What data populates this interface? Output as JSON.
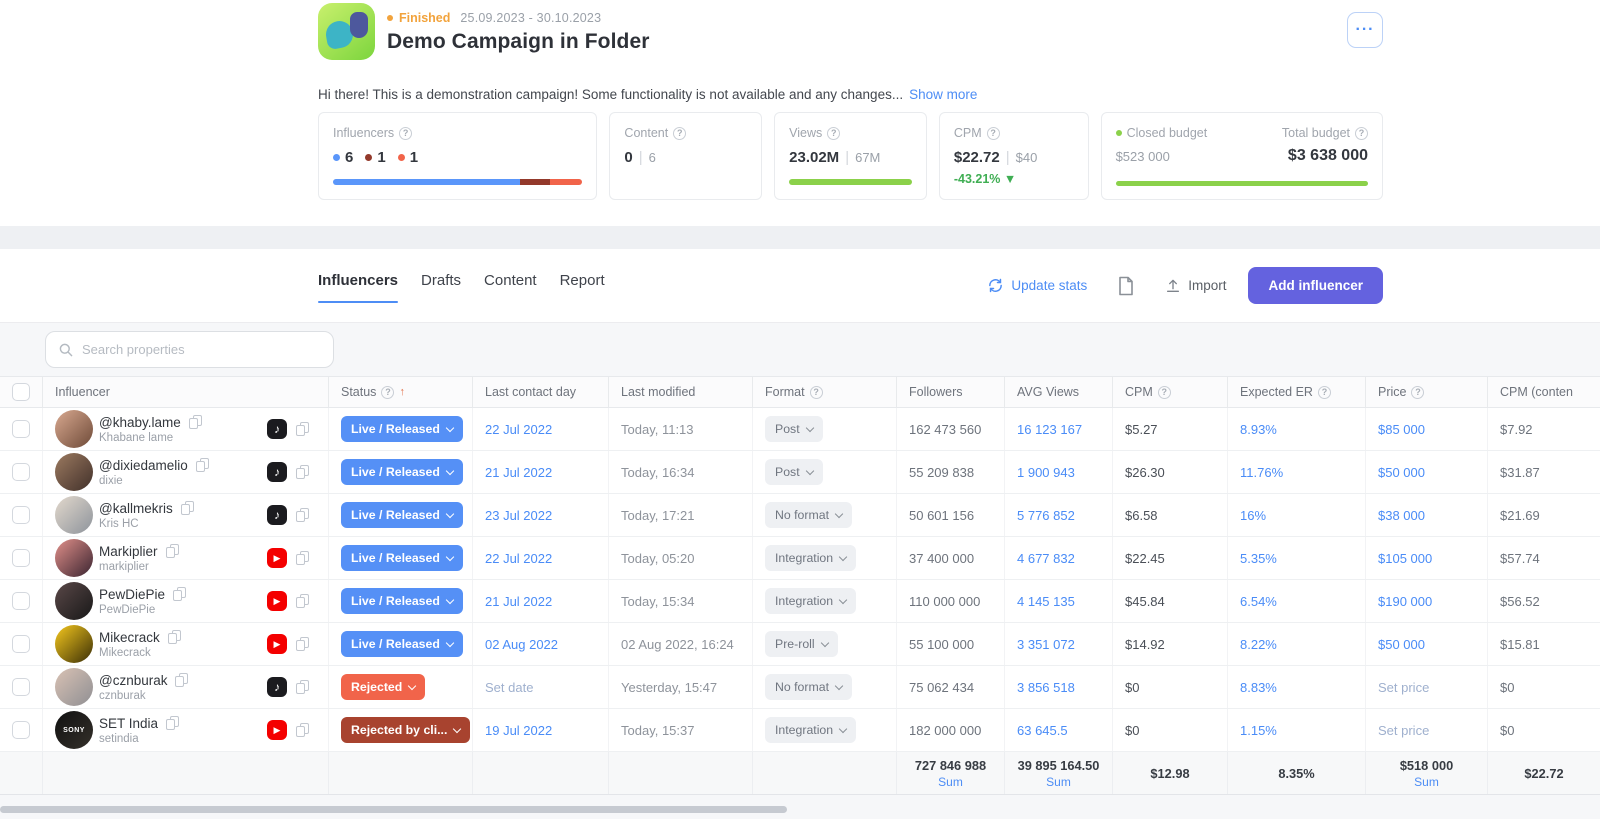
{
  "header": {
    "status_badge": "Finished",
    "date_range": "25.09.2023 - 30.10.2023",
    "title": "Demo Campaign in Folder",
    "menu_label": "···",
    "description": "Hi there! This is a demonstration campaign! Some functionality is not available and any changes...",
    "show_more_label": "Show more"
  },
  "stats": {
    "influencers": {
      "label": "Influencers",
      "items": [
        {
          "count": "6",
          "color": "#5a96fa",
          "width": "75%"
        },
        {
          "count": "1",
          "color": "#93392b",
          "width": "12%"
        },
        {
          "count": "1",
          "color": "#f1644a",
          "width": "13%"
        }
      ]
    },
    "content": {
      "label": "Content",
      "value": "0",
      "total": "6"
    },
    "views": {
      "label": "Views",
      "value": "23.02M",
      "total": "67M",
      "progress": "100%",
      "bar_color": "#8bd14a"
    },
    "cpm": {
      "label": "CPM",
      "value": "$22.72",
      "total": "$40",
      "delta": "-43.21% ▼",
      "delta_color": "#3fae53"
    },
    "budget": {
      "closed_label": "Closed budget",
      "closed_value": "$523 000",
      "total_label": "Total budget",
      "total_value": "$3 638 000",
      "progress": "100%",
      "bar_color": "#8bd14a",
      "dot_color": "#8bd14a"
    }
  },
  "tabs": [
    {
      "label": "Influencers"
    },
    {
      "label": "Drafts"
    },
    {
      "label": "Content"
    },
    {
      "label": "Report"
    }
  ],
  "toolbar": {
    "update_stats": "Update stats",
    "import_label": "Import",
    "add_influencer": "Add influencer"
  },
  "search": {
    "placeholder": "Search properties"
  },
  "table": {
    "columns": [
      {
        "label": "Influencer"
      },
      {
        "label": "Status"
      },
      {
        "label": "Last contact day"
      },
      {
        "label": "Last modified"
      },
      {
        "label": "Format"
      },
      {
        "label": "Followers"
      },
      {
        "label": "AVG Views"
      },
      {
        "label": "CPM"
      },
      {
        "label": "Expected ER"
      },
      {
        "label": "Price"
      },
      {
        "label": "CPM (conten"
      }
    ],
    "rows": [
      {
        "handle": "@khaby.lame",
        "name": "Khabane lame",
        "platform": "tiktok",
        "avatar": [
          "#d9a990",
          "#6e4a38"
        ],
        "status": "Live / Released",
        "status_type": "live",
        "last_contact": "22 Jul 2022",
        "last_modified": "Today, 11:13",
        "format": "Post",
        "followers": "162 473 560",
        "avg_views": "16 123 167",
        "cpm": "$5.27",
        "expected_er": "8.93%",
        "price": "$85 000",
        "cpm_content": "$7.92"
      },
      {
        "handle": "@dixiedamelio",
        "name": "dixie",
        "platform": "tiktok",
        "avatar": [
          "#9c7a60",
          "#41302a"
        ],
        "status": "Live / Released",
        "status_type": "live",
        "last_contact": "21 Jul 2022",
        "last_modified": "Today, 16:34",
        "format": "Post",
        "followers": "55 209 838",
        "avg_views": "1 900 943",
        "cpm": "$26.30",
        "expected_er": "11.76%",
        "price": "$50 000",
        "cpm_content": "$31.87"
      },
      {
        "handle": "@kallmekris",
        "name": "Kris HC",
        "platform": "tiktok",
        "avatar": [
          "#e3d9cd",
          "#8d939b"
        ],
        "status": "Live / Released",
        "status_type": "live",
        "last_contact": "23 Jul 2022",
        "last_modified": "Today, 17:21",
        "format": "No format",
        "followers": "50 601 156",
        "avg_views": "5 776 852",
        "cpm": "$6.58",
        "expected_er": "16%",
        "price": "$38 000",
        "cpm_content": "$21.69"
      },
      {
        "handle": "Markiplier",
        "name": "markiplier",
        "platform": "youtube",
        "avatar": [
          "#e2908a",
          "#3a2430"
        ],
        "status": "Live / Released",
        "status_type": "live",
        "last_contact": "22 Jul 2022",
        "last_modified": "Today, 05:20",
        "format": "Integration",
        "followers": "37 400 000",
        "avg_views": "4 677 832",
        "cpm": "$22.45",
        "expected_er": "5.35%",
        "price": "$105 000",
        "cpm_content": "$57.74"
      },
      {
        "handle": "PewDiePie",
        "name": "PewDiePie",
        "platform": "youtube",
        "avatar": [
          "#5a4848",
          "#181818"
        ],
        "status": "Live / Released",
        "status_type": "live",
        "last_contact": "21 Jul 2022",
        "last_modified": "Today, 15:34",
        "format": "Integration",
        "followers": "110 000 000",
        "avg_views": "4 145 135",
        "cpm": "$45.84",
        "expected_er": "6.54%",
        "price": "$190 000",
        "cpm_content": "$56.52"
      },
      {
        "handle": "Mikecrack",
        "name": "Mikecrack",
        "platform": "youtube",
        "avatar": [
          "#f6c91e",
          "#3a2e06"
        ],
        "status": "Live / Released",
        "status_type": "live",
        "last_contact": "02 Aug 2022",
        "last_modified": "02 Aug 2022, 16:24",
        "format": "Pre-roll",
        "followers": "55 100 000",
        "avg_views": "3 351 072",
        "cpm": "$14.92",
        "expected_er": "8.22%",
        "price": "$50 000",
        "cpm_content": "$15.81"
      },
      {
        "handle": "@cznburak",
        "name": "cznburak",
        "platform": "tiktok",
        "avatar": [
          "#d9c2b4",
          "#8f8f93"
        ],
        "status": "Rejected",
        "status_type": "rejected",
        "last_contact": "Set date",
        "contact_placeholder": true,
        "last_modified": "Yesterday, 15:47",
        "format": "No format",
        "followers": "75 062 434",
        "avg_views": "3 856 518",
        "cpm": "$0",
        "expected_er": "8.83%",
        "price": "Set price",
        "price_placeholder": true,
        "cpm_content": "$0"
      },
      {
        "handle": "SET India",
        "name": "setindia",
        "platform": "youtube",
        "avatar": [
          "#111111",
          "#34302a"
        ],
        "avatar_text": "SONY",
        "status": "Rejected by cli...",
        "status_type": "rejected-client",
        "last_contact": "19 Jul 2022",
        "last_modified": "Today, 15:37",
        "format": "Integration",
        "followers": "182 000 000",
        "avg_views": "63 645.5",
        "cpm": "$0",
        "expected_er": "1.15%",
        "price": "Set price",
        "price_placeholder": true,
        "cpm_content": "$0"
      }
    ],
    "summary": {
      "followers": "727 846 988",
      "followers_sum": "Sum",
      "avg_views": "39 895 164.50",
      "avg_views_sum": "Sum",
      "cpm": "$12.98",
      "expected_er": "8.35%",
      "price": "$518 000",
      "price_sum": "Sum",
      "cpm_content": "$22.72"
    }
  }
}
